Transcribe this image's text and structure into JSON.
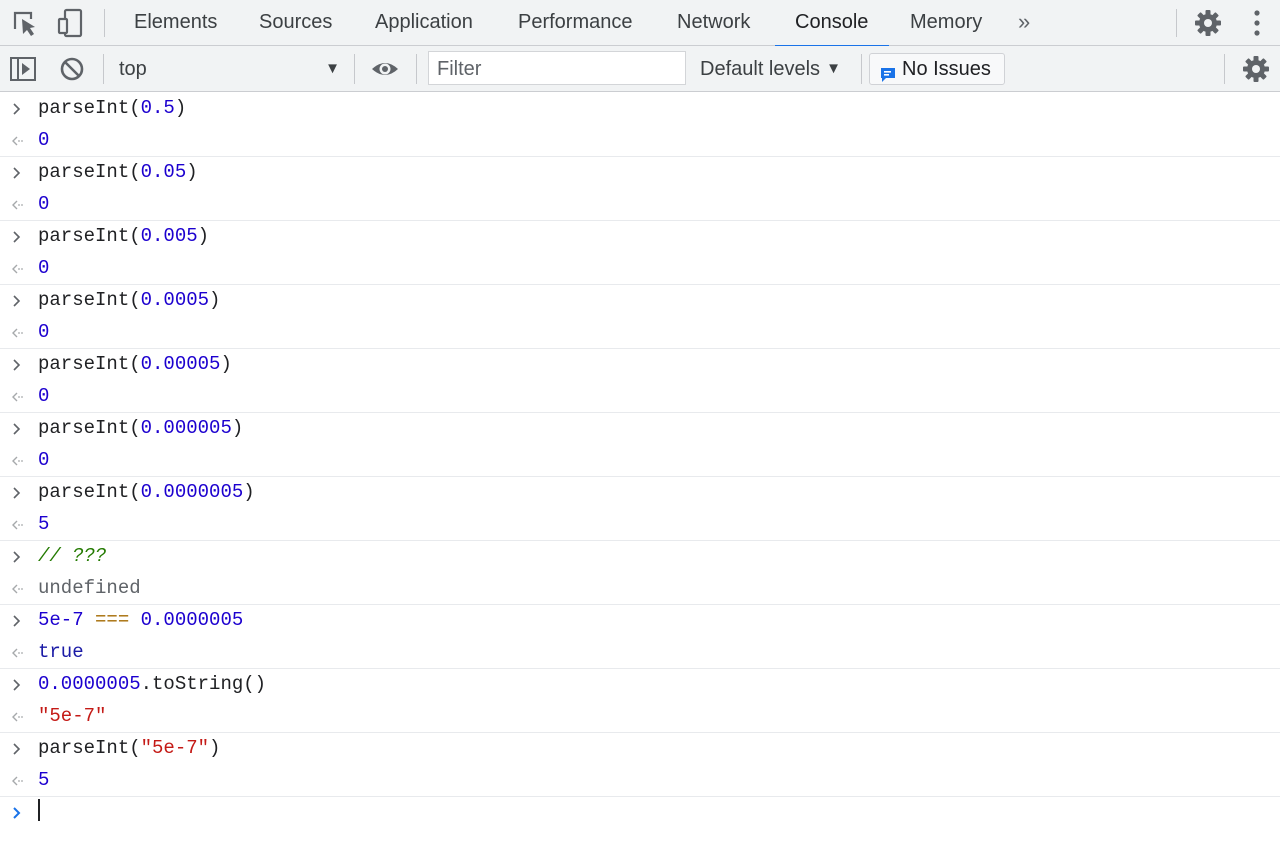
{
  "tabs": [
    {
      "label": "Elements"
    },
    {
      "label": "Sources"
    },
    {
      "label": "Application"
    },
    {
      "label": "Performance"
    },
    {
      "label": "Network"
    },
    {
      "label": "Console",
      "active": true
    },
    {
      "label": "Memory"
    }
  ],
  "more_tabs_glyph": "»",
  "toolbar": {
    "context": "top",
    "filter_placeholder": "Filter",
    "levels_label": "Default levels",
    "issues_label": "No Issues"
  },
  "colors": {
    "accent": "#1a73e8",
    "number": "#1c00cf",
    "string": "#c41a16",
    "operator": "#a46a00",
    "comment": "#237a00"
  },
  "console": [
    {
      "input": [
        "parseInt(",
        "0.5",
        ")"
      ],
      "output": "0"
    },
    {
      "input": [
        "parseInt(",
        "0.05",
        ")"
      ],
      "output": "0"
    },
    {
      "input": [
        "parseInt(",
        "0.005",
        ")"
      ],
      "output": "0"
    },
    {
      "input": [
        "parseInt(",
        "0.0005",
        ")"
      ],
      "output": "0"
    },
    {
      "input": [
        "parseInt(",
        "0.00005",
        ")"
      ],
      "output": "0"
    },
    {
      "input": [
        "parseInt(",
        "0.000005",
        ")"
      ],
      "output": "0"
    },
    {
      "input": [
        "parseInt(",
        "0.0000005",
        ")"
      ],
      "output": "5"
    },
    {
      "input": [
        "// ???"
      ],
      "output": "undefined"
    },
    {
      "input": [
        "5e-7",
        " === ",
        "0.0000005"
      ],
      "output": "true"
    },
    {
      "input": [
        "0.0000005",
        ".toString()"
      ],
      "output": "\"5e-7\""
    },
    {
      "input": [
        "parseInt(",
        "\"5e-7\"",
        ")"
      ],
      "output": "5"
    }
  ]
}
